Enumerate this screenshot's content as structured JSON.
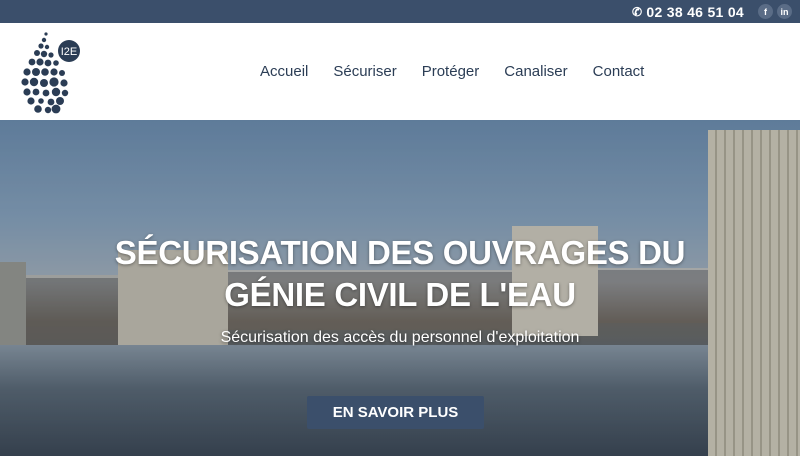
{
  "topbar": {
    "phone_icon": "phone-icon",
    "phone": "02 38 46 51 04",
    "social": [
      {
        "label": "f",
        "name": "facebook-icon"
      },
      {
        "label": "in",
        "name": "linkedin-icon"
      }
    ]
  },
  "logo": {
    "text": "I2E"
  },
  "nav": {
    "items": [
      {
        "label": "Accueil",
        "active": true
      },
      {
        "label": "Sécuriser"
      },
      {
        "label": "Protéger"
      },
      {
        "label": "Canaliser"
      },
      {
        "label": "Contact"
      }
    ]
  },
  "hero": {
    "title_line1": "SÉCURISATION DES OUVRAGES DU",
    "title_line2": "GÉNIE CIVIL DE L'EAU",
    "subtitle": "Sécurisation des accès du personnel d'exploitation",
    "cta_label": "EN SAVOIR PLUS"
  },
  "colors": {
    "brand": "#3b4f6b",
    "nav_text": "#2b3d55"
  }
}
